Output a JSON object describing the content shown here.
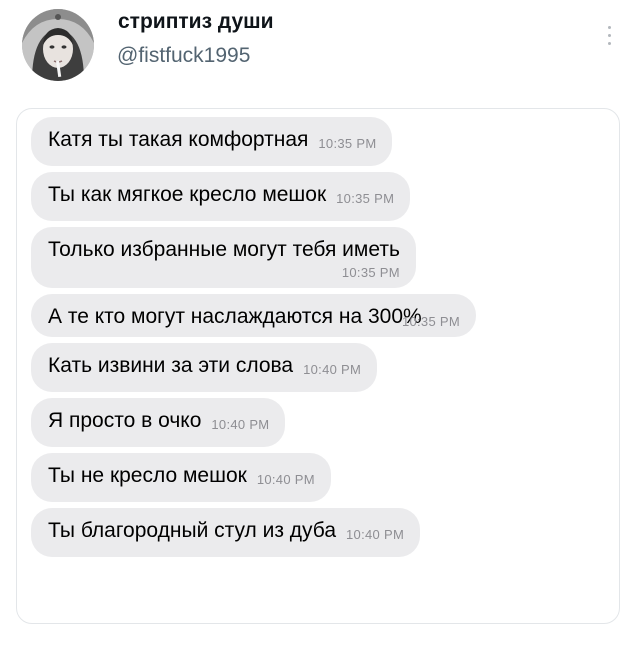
{
  "profile": {
    "display_name": "стриптиз души",
    "handle": "@fistfuck1995",
    "avatar_icon": "profile-photo",
    "more_icon": "vertical-ellipsis-icon"
  },
  "messages": [
    {
      "text": "Катя ты такая комфортная",
      "time": "10:35 PM"
    },
    {
      "text": "Ты как мягкое кресло мешок",
      "time": "10:35 PM"
    },
    {
      "text": "Только избранные могут тебя иметь",
      "time": "10:35 PM"
    },
    {
      "text": "А те кто могут наслаждаются на 300%",
      "time": "10:35 PM"
    },
    {
      "text": "Кать извини за эти слова",
      "time": "10:40 PM"
    },
    {
      "text": "Я просто в очко",
      "time": "10:40 PM"
    },
    {
      "text": "Ты не кресло мешок",
      "time": "10:40 PM"
    },
    {
      "text": "Ты благородный стул из дуба",
      "time": "10:40 PM"
    }
  ],
  "colors": {
    "bubble_bg": "#ebebed",
    "timestamp": "#8e8e93",
    "handle": "#536471"
  }
}
